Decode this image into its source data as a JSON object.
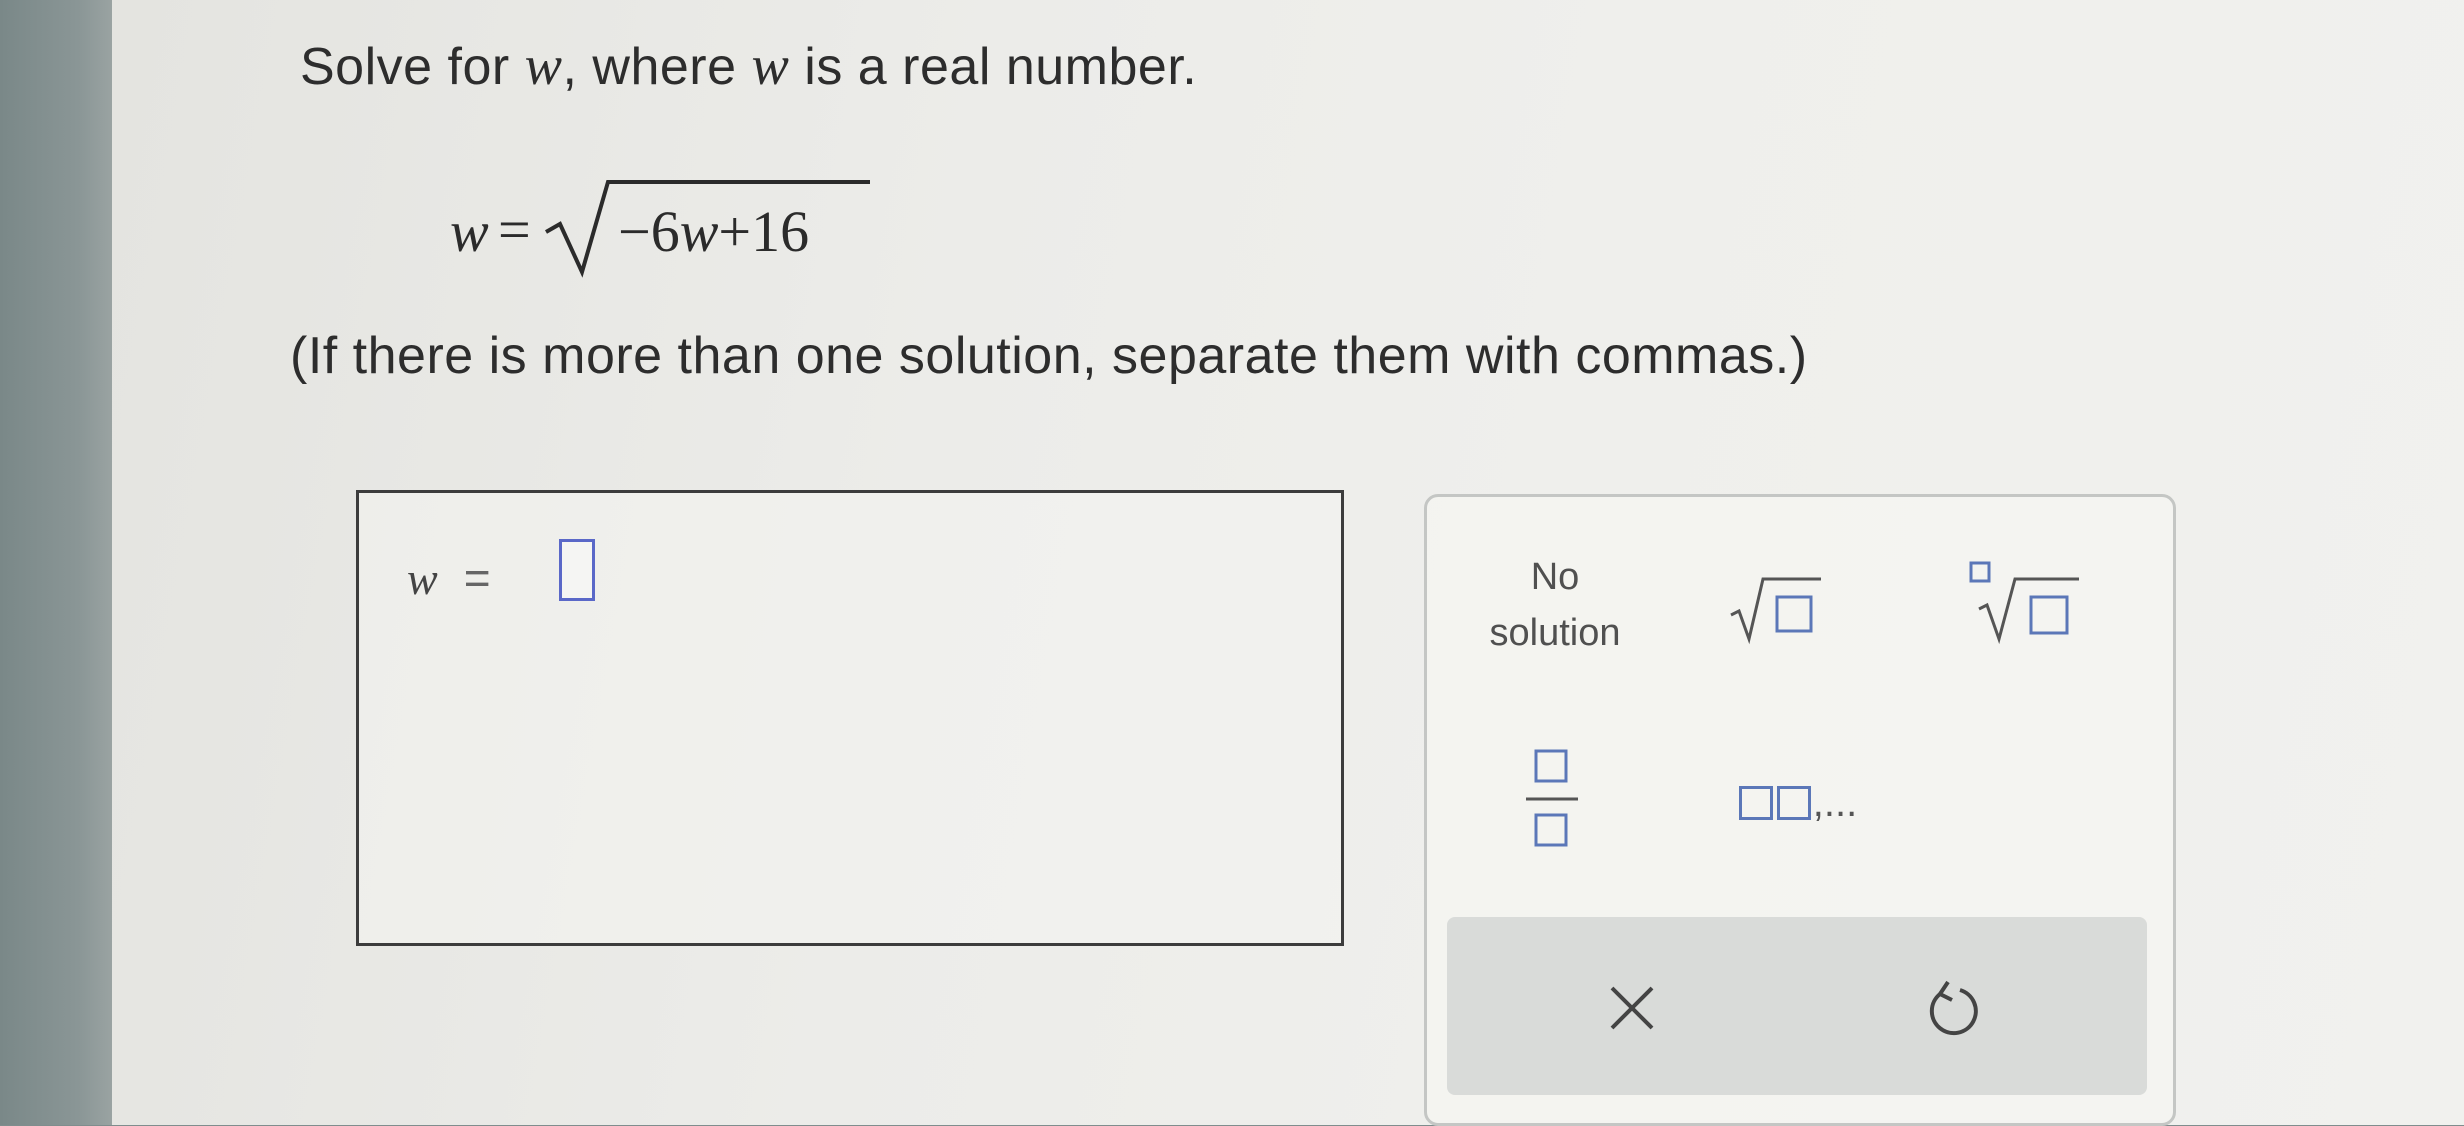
{
  "question": {
    "prefix": "Solve for ",
    "variable": "w",
    "middle": ", where ",
    "suffix": " is a real number."
  },
  "equation": {
    "lhs": "w",
    "equals": "=",
    "radicand_prefix": "−6",
    "radicand_var": "w",
    "radicand_suffix": "+16"
  },
  "instruction": "(If there is more than one solution, separate them with commas.)",
  "answer": {
    "lhs": "w",
    "equals": "=",
    "value": ""
  },
  "keypad": {
    "no_solution_line1": "No",
    "no_solution_line2": "solution",
    "list_suffix": ",...",
    "clear_symbol": "✕",
    "accent_color": "#5b77b8"
  }
}
